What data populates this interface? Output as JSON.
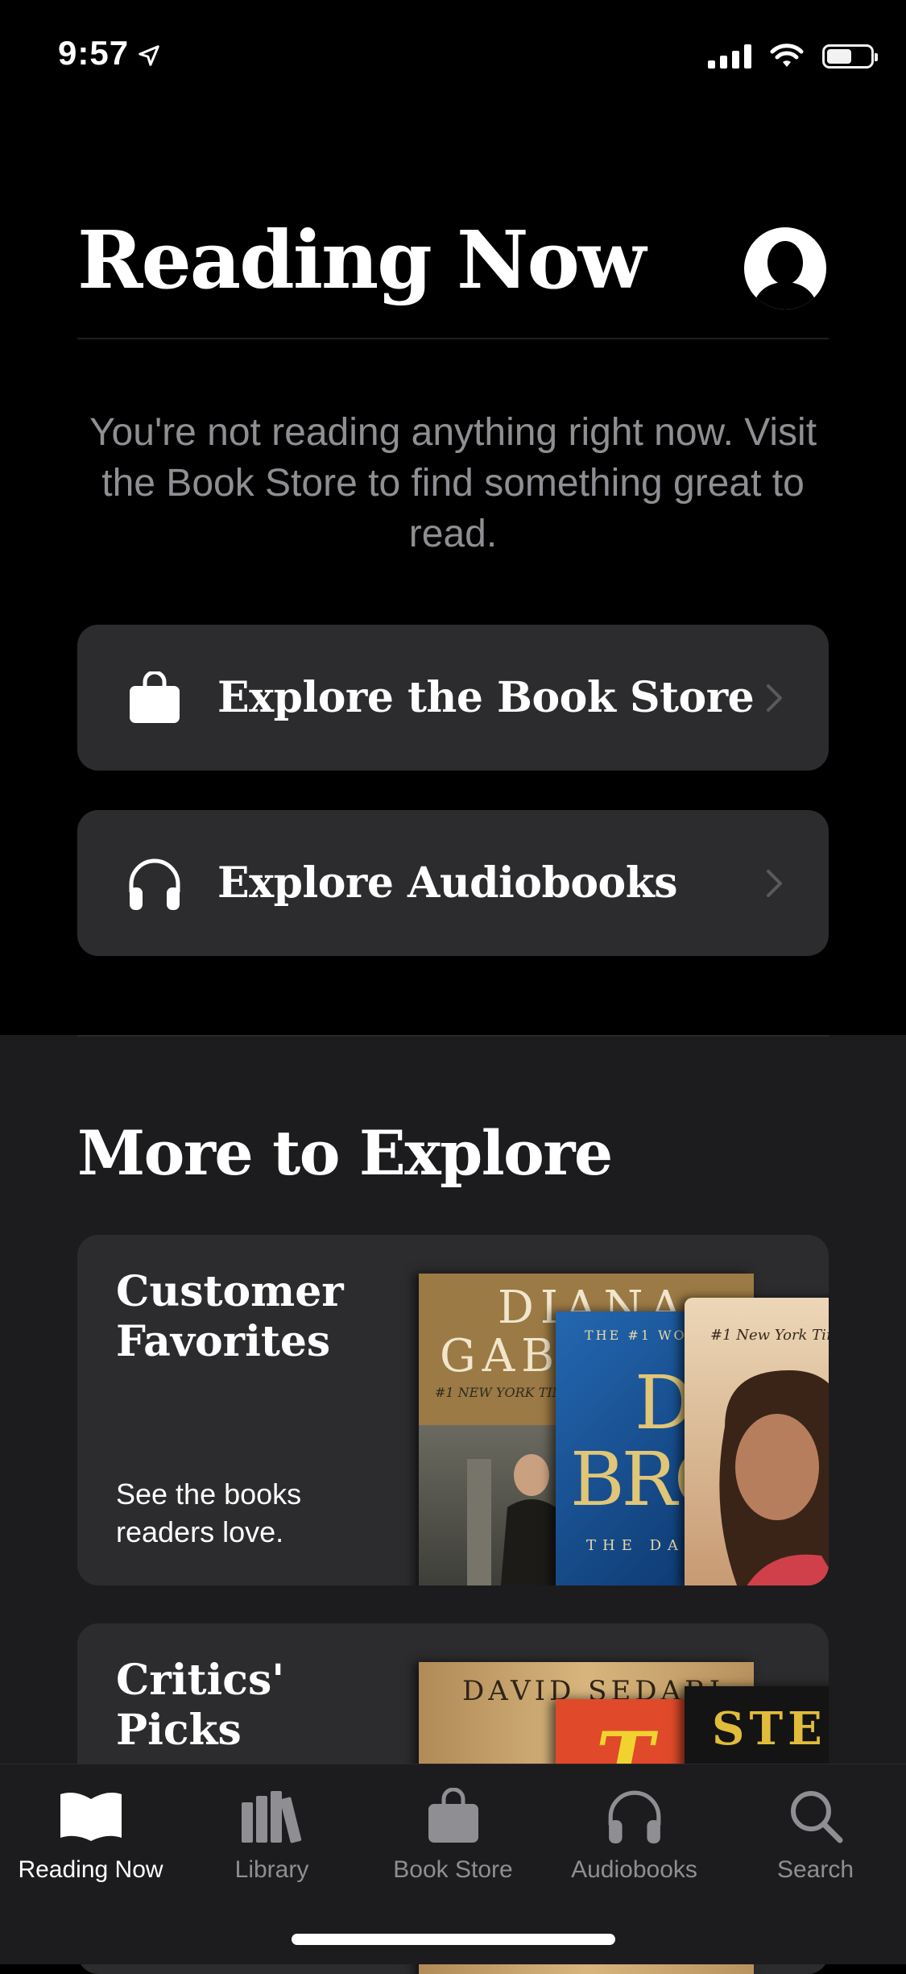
{
  "status": {
    "time": "9:57"
  },
  "header": {
    "title": "Reading Now"
  },
  "empty_message": "You're not reading anything right now. Visit the Book Store to find something great to read.",
  "actions": [
    {
      "label": "Explore the Book Store",
      "icon": "shopping-bag-icon"
    },
    {
      "label": "Explore Audiobooks",
      "icon": "headphones-icon"
    }
  ],
  "more": {
    "title": "More to Explore",
    "cards": [
      {
        "title": "Customer Favorites",
        "subtitle": "See the books readers love.",
        "covers": [
          {
            "author_a": "DIANA",
            "author_b": "GABA",
            "tagline": "#1 NEW YORK TIM",
            "color": "#8a6a3a"
          },
          {
            "top": "THE #1 WO",
            "mark_a": "D",
            "mark_b": "BRO",
            "bottom": "THE DA",
            "color": "#1c4f8f"
          },
          {
            "tagline": "#1 New York Tim",
            "color": "#d9b99a"
          }
        ]
      },
      {
        "title": "Critics' Picks",
        "covers": [
          {
            "author": "DAVID SEDARI",
            "color": "#c9a66b"
          },
          {
            "mark": "T",
            "color": "#e04a2a"
          },
          {
            "mark": "STE",
            "color": "#1a1a1a"
          }
        ]
      }
    ]
  },
  "tabs": [
    {
      "label": "Reading Now",
      "icon": "book-open-icon",
      "active": true
    },
    {
      "label": "Library",
      "icon": "library-icon",
      "active": false
    },
    {
      "label": "Book Store",
      "icon": "shopping-bag-icon",
      "active": false
    },
    {
      "label": "Audiobooks",
      "icon": "headphones-icon",
      "active": false
    },
    {
      "label": "Search",
      "icon": "search-icon",
      "active": false
    }
  ],
  "colors": {
    "background": "#000000",
    "card": "#2c2c2e",
    "section": "#1c1c1e",
    "secondary_text": "#8e8e93"
  }
}
